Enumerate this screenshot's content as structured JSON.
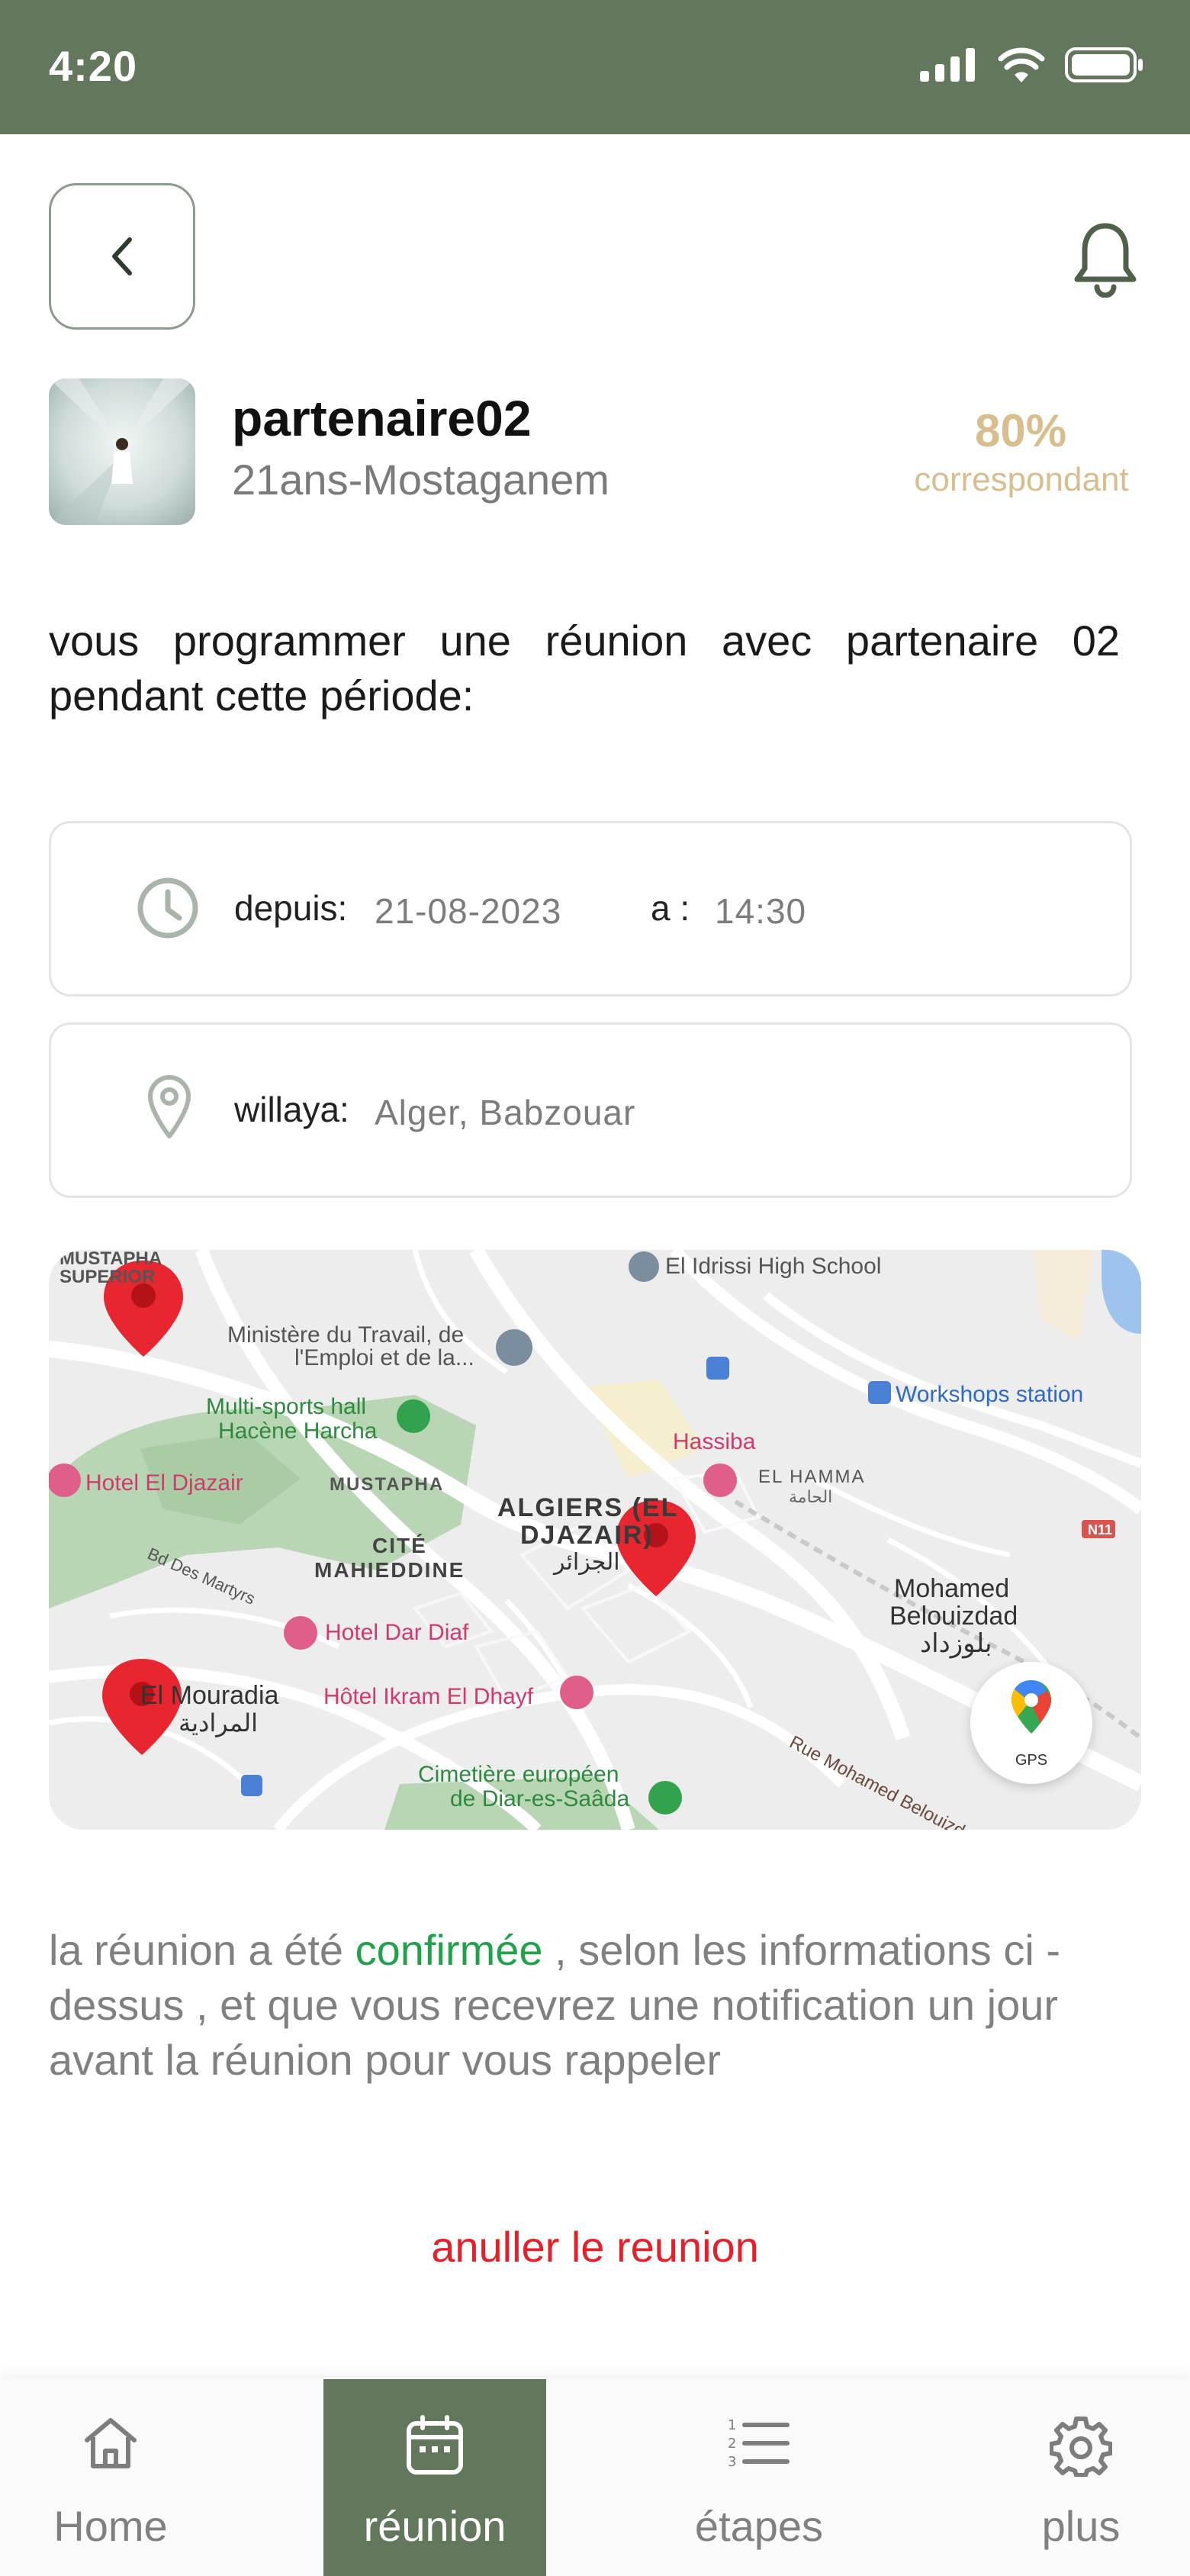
{
  "status_bar": {
    "time": "4:20"
  },
  "profile": {
    "name": "partenaire02",
    "subtitle": "21ans-Mostaganem",
    "match_percent": "80%",
    "match_label": "correspondant"
  },
  "intro_text": "vous programmer une réunion avec partenaire 02 pendant cette période:",
  "schedule": {
    "from_label": "depuis:",
    "date": "21-08-2023",
    "at_label": "a :",
    "time": "14:30"
  },
  "location": {
    "label": "willaya:",
    "value": "Alger, Babzouar"
  },
  "map": {
    "labels": {
      "mustapha_super": "MUSTAPHA SUPERIOR",
      "el_idrissi": "El Idrissi High School",
      "ministere_1": "Ministère du Travail, de",
      "ministere_2": "l'Emploi et de la...",
      "multisports_1": "Multi-sports hall",
      "multisports_2": "Hacène Harcha",
      "workshops": "Workshops station",
      "hotel_djazair": "Hotel El Djazair",
      "mustapha": "MUSTAPHA",
      "hassiba": "Hassiba",
      "el_hamma": "EL HAMMA",
      "el_hamma_ar": "الحامة",
      "algiers_1": "ALGIERS (EL",
      "algiers_2": "DJAZAIR)",
      "algiers_ar": "الجزائر",
      "cite_1": "CITÉ",
      "cite_2": "MAHIEDDINE",
      "bd_martyrs": "Bd Des Martyrs",
      "n11": "N11",
      "mohamed_1": "Mohamed",
      "mohamed_2": "Belouizdad",
      "mohamed_ar": "بلوزداد",
      "hotel_dar_diaf": "Hotel Dar Diaf",
      "mouradia": "El Mouradia",
      "mouradia_ar": "المرادية",
      "hotel_ikram": "Hôtel Ikram El Dhayf",
      "rue_mohamed": "Rue Mohamed Belouizdad",
      "cimetiere_1": "Cimetière européen",
      "cimetiere_2": "de Diar-es-Saâda"
    },
    "gps_label": "GPS"
  },
  "confirmation": {
    "before": "la réunion a été",
    "highlight": "confirmée",
    "after": ", selon les informations ci -dessus , et que vous recevrez une notification un jour avant la réunion pour vous rappeler"
  },
  "cancel_label": "anuller le reunion",
  "nav": {
    "home": "Home",
    "reunion": "réunion",
    "etapes": "étapes",
    "plus": "plus"
  },
  "colors": {
    "brand_green": "#63775c",
    "match_gold": "#d8bd8f",
    "confirm_green": "#1fa24a",
    "cancel_red": "#e6202a"
  }
}
